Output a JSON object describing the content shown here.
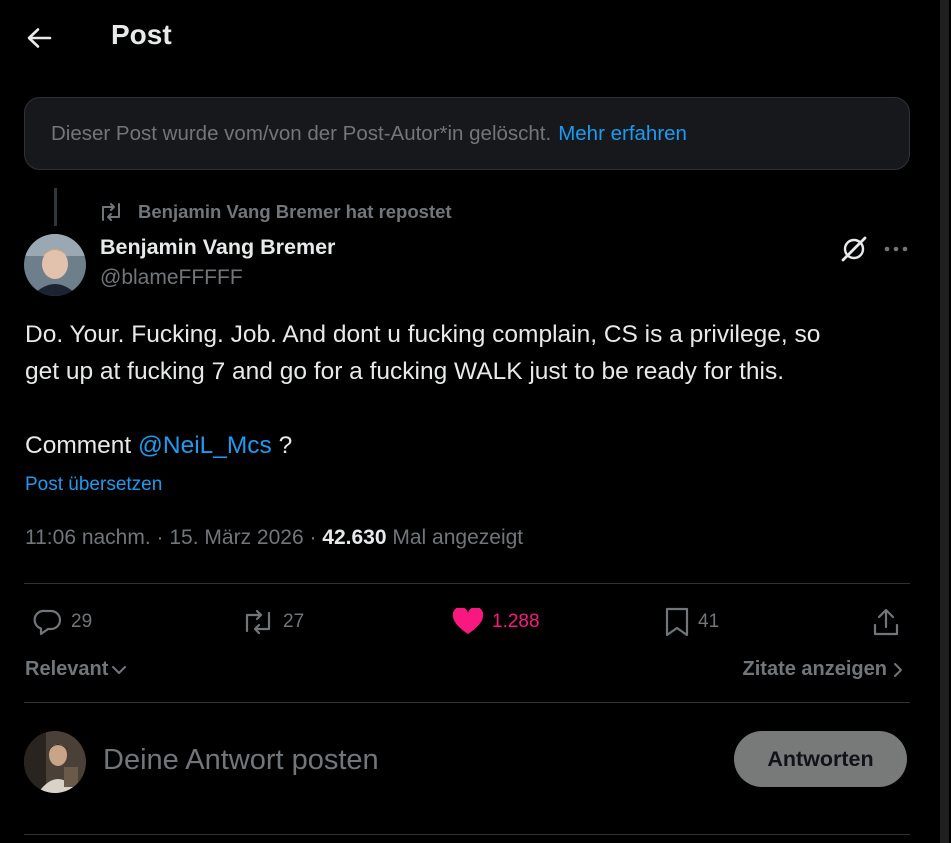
{
  "header": {
    "title": "Post",
    "back_icon": "arrow-left-icon"
  },
  "deleted_notice": {
    "text": "Dieser Post wurde vom/von der Post-Autor*in gelöscht.",
    "link": "Mehr erfahren"
  },
  "repost": {
    "icon": "repost-icon",
    "text": "Benjamin Vang Bremer hat repostet"
  },
  "author": {
    "name": "Benjamin Vang Bremer",
    "handle": "@blameFFFFF"
  },
  "post": {
    "line1": "Do. Your. Fucking. Job. And dont u fucking complain, CS is a privilege, so",
    "line2": "get up at fucking 7 and go for a fucking WALK just to be ready for this.",
    "comment_prefix": "Comment",
    "mention": "@NeiL_Mcs",
    "comment_suffix": " ?",
    "translate": "Post übersetzen"
  },
  "meta": {
    "time": "11:06 nachm.",
    "sep": " · ",
    "date": "15. März 2026",
    "views": "42.630",
    "views_label": "Mal angezeigt"
  },
  "actions": {
    "replies": "29",
    "reposts": "27",
    "likes": "1.288",
    "bookmarks": "41"
  },
  "colors": {
    "accent": "#1d9bf0",
    "like": "#f91880",
    "muted": "#71767b",
    "text": "#e7e9ea",
    "background": "#000000"
  },
  "filter": {
    "label": "Relevant",
    "quotes": "Zitate anzeigen"
  },
  "reply": {
    "placeholder": "Deine Antwort posten",
    "button": "Antworten"
  }
}
